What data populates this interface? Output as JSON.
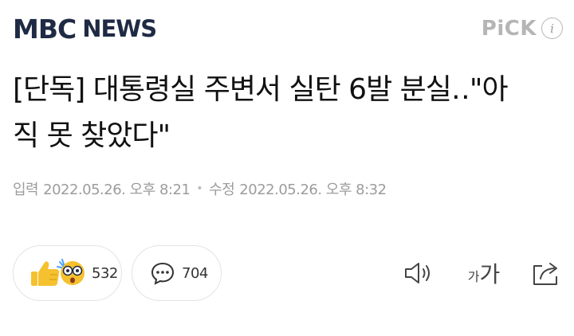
{
  "header": {
    "logo_primary": "MBC",
    "logo_secondary": "NEWS",
    "pick_label": "PiCK",
    "info_glyph": "i"
  },
  "article": {
    "title": "[단독] 대통령실 주변서 실탄 6발 분실‥\"아직 못 찾았다\"",
    "published_label": "입력",
    "published": "2022.05.26. 오후 8:21",
    "updated_label": "수정",
    "updated": "2022.05.26. 오후 8:32"
  },
  "reactions": {
    "count": "532",
    "icons": [
      "thumbs-up-icon",
      "surprised-face-icon"
    ]
  },
  "comments": {
    "count": "704",
    "icon": "comment-bubble-icon"
  },
  "toolbar": {
    "sound_icon": "speaker-icon",
    "font_small": "가",
    "font_big": "가",
    "share_icon": "share-icon"
  },
  "colors": {
    "logo": "#1f2a44",
    "pick": "#b5b5b5",
    "meta": "#9c9c9c",
    "border": "#e3e3e3",
    "reaction_yellow": "#f5c12e"
  }
}
